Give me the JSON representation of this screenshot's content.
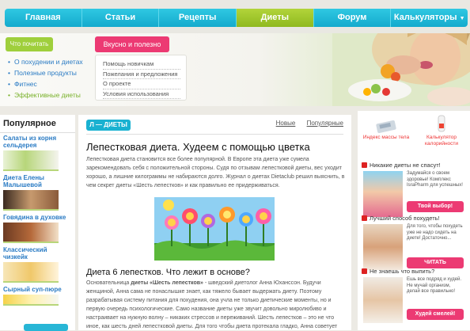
{
  "nav": {
    "items": [
      "Главная",
      "Статьи",
      "Рецепты",
      "Диеты",
      "Форум",
      "Калькуляторы"
    ],
    "active_index": 3
  },
  "hero": {
    "btn_read": "Что почитать",
    "btn_tasty": "Вкусно и полезно",
    "read_links": [
      "О похудении и диетах",
      "Полезные продукты",
      "Фитнес",
      "Эффективные диеты"
    ],
    "sub_links": [
      "Помощь новичкам",
      "Пожелания и предложения",
      "О проекте",
      "Условия использования"
    ]
  },
  "left": {
    "title": "Популярное",
    "items": [
      {
        "title": "Салаты из корня сельдерея",
        "icon": "celery-salad-image"
      },
      {
        "title": "Диета Елены Малышевой",
        "icon": "woman-portrait-image"
      },
      {
        "title": "Говядина в духовке",
        "icon": "beef-dish-image"
      },
      {
        "title": "Классический чизкейк",
        "icon": "cheesecake-image"
      },
      {
        "title": "Сырный суп-пюре",
        "icon": "soup-image"
      }
    ]
  },
  "main": {
    "tag": "Л — ДИЕТЫ",
    "sort_new": "Новые",
    "sort_popular": "Популярные",
    "title": "Лепестковая диета. Худеем с помощью цветка",
    "p1": "Лепестковая диета становится все более популярной. В Европе эта диета уже сумела зарекомендовать себя с положительной стороны. Судя по отзывам лепестковой диеты, вес уходит хорошо, а лишние килограммы не набираются долго. Журнал о диетах Dietaclub решил выяснить, в чем секрет диеты «Шесть лепестков» и как правильно ее придерживаться.",
    "subtitle": "Диета 6 лепестков. Что лежит в основе?",
    "p2_lead": "Основательница",
    "p2_bold": "диеты «Шесть лепестков»",
    "p2_rest": " - шведский диетолог Анна Юханссон. Будучи женщиной, Анна сама не понаслышке знает, как тяжело бывает выдержать диету. Поэтому разрабатывая систему питания для похудения, она учла не только диетические моменты, но и первую очередь психологические. Само название диеты уже звучит довольно миролюбиво и настраивает на нужную волну – никаких стрессов и переживаний. Шесть лепестков – это не что иное, как шесть дней лепестковой диеты. Для того чтобы диета протекала гладко, Анна советует"
  },
  "right": {
    "calc1": "Индекс массы тела",
    "calc2": "Калькулятор калорийности",
    "ads": [
      {
        "head": "Никакие диеты не спасут!",
        "text": "Задумайся о своем здоровье! Комплекс IsraPharm для успешных!",
        "btn": "Твой выбор!",
        "btn_color": "#ec3a73"
      },
      {
        "head": "Лучший способ похудеть!",
        "text": "Для того, чтобы похудеть уже не надо сидеть на диете! Достаточно...",
        "btn": "ЧИТАТЬ",
        "btn_color": "#ec3a73"
      },
      {
        "head": "Не знаешь что выпить?",
        "text": "Ешь все подряд и худей. Не мучай организм, делай все правильно!",
        "btn": "Худей смелей!",
        "btn_color": "#ec3a73"
      }
    ]
  },
  "colors": {
    "nav": "#19b1d1",
    "active": "#9fcf3c",
    "accent": "#ec3a73",
    "link": "#2a7bc4"
  }
}
